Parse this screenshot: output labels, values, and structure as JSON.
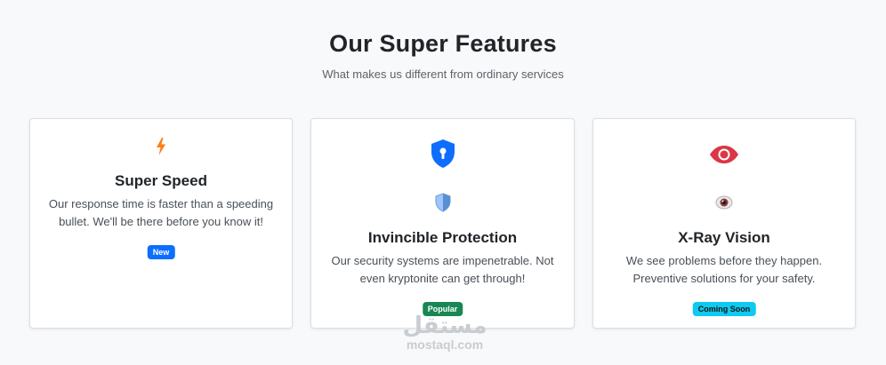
{
  "header": {
    "title": "Our Super Features",
    "subtitle": "What makes us different from ordinary services"
  },
  "cards": [
    {
      "icons": [
        "lightning-icon"
      ],
      "title": "Super Speed",
      "text": "Our response time is faster than a speeding bullet. We'll be there before you know it!",
      "badge": "New",
      "badge_color": "#0d6efd"
    },
    {
      "icons": [
        "shield-keyhole-icon",
        "shield-emoji-icon"
      ],
      "title": "Invincible Protection",
      "text": "Our security systems are impenetrable. Not even kryptonite can get through!",
      "badge": "Popular",
      "badge_color": "#198754"
    },
    {
      "icons": [
        "eye-icon",
        "eye-emoji-icon"
      ],
      "title": "X-Ray Vision",
      "text": "We see problems before they happen. Preventive solutions for your safety.",
      "badge": "Coming Soon",
      "badge_color": "#0dcaf0"
    }
  ],
  "colors": {
    "primary": "#0d6efd",
    "danger": "#dc3545",
    "warning": "#fd7e14",
    "background": "#f8f9fa"
  },
  "watermark": {
    "arabic": "مستقل",
    "latin": "mostaql.com"
  }
}
